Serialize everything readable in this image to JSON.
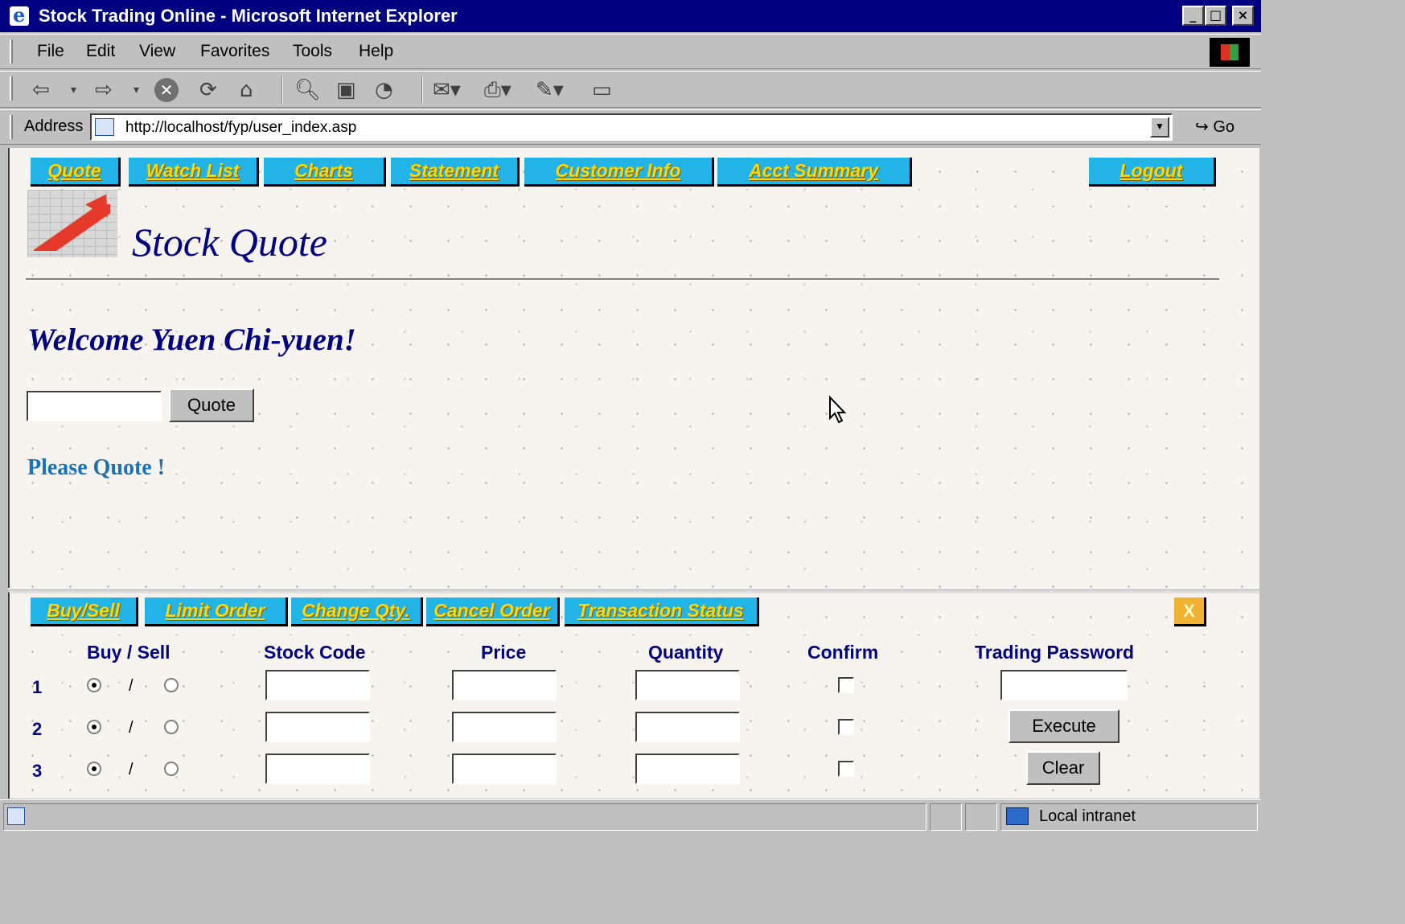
{
  "window": {
    "title": "Stock Trading Online - Microsoft Internet Explorer",
    "controls": [
      "_",
      "□",
      "×"
    ]
  },
  "menu": {
    "items": [
      {
        "label": "File"
      },
      {
        "label": "Edit"
      },
      {
        "label": "View"
      },
      {
        "label": "Favorites"
      },
      {
        "label": "Tools"
      },
      {
        "label": "Help"
      }
    ]
  },
  "toolbar": {
    "icons": [
      "back-icon",
      "forward-icon",
      "stop-icon",
      "refresh-icon",
      "home-icon",
      "search-icon",
      "favorites-icon",
      "history-icon",
      "mail-icon",
      "print-icon",
      "edit-icon",
      "fullscreen-icon"
    ]
  },
  "address": {
    "label": "Address",
    "url": "http://localhost/fyp/user_index.asp",
    "go_label": "Go"
  },
  "top_nav": {
    "items": [
      {
        "label": "Quote"
      },
      {
        "label": "Watch List"
      },
      {
        "label": "Charts"
      },
      {
        "label": "Statement"
      },
      {
        "label": "Customer Info"
      },
      {
        "label": "Acct Summary"
      }
    ],
    "logout": "Logout"
  },
  "page": {
    "title": "Stock Quote",
    "welcome": "Welcome Yuen Chi-yuen!",
    "quote_input_value": "",
    "quote_button": "Quote",
    "message": "Please Quote !"
  },
  "trade_nav": {
    "items": [
      {
        "label": "Buy/Sell"
      },
      {
        "label": "Limit Order"
      },
      {
        "label": "Change Qty."
      },
      {
        "label": "Cancel Order"
      },
      {
        "label": "Transaction Status"
      }
    ],
    "close": "X"
  },
  "trade_form": {
    "headers": {
      "buy_sell": "Buy / Sell",
      "stock_code": "Stock Code",
      "price": "Price",
      "quantity": "Quantity",
      "confirm": "Confirm",
      "trading_password": "Trading Password"
    },
    "rows": [
      {
        "num": "1",
        "buy_selected": true,
        "separator": "/",
        "stock_code": "",
        "price": "",
        "quantity": "",
        "confirm": false
      },
      {
        "num": "2",
        "buy_selected": true,
        "separator": "/",
        "stock_code": "",
        "price": "",
        "quantity": "",
        "confirm": false
      },
      {
        "num": "3",
        "buy_selected": true,
        "separator": "/",
        "stock_code": "",
        "price": "",
        "quantity": "",
        "confirm": false
      }
    ],
    "password_value": "",
    "execute_button": "Execute",
    "clear_button": "Clear"
  },
  "status_bar": {
    "zone": "Local intranet"
  },
  "colors": {
    "titlebar": "#000080",
    "nav_button_bg": "#22b4e6",
    "nav_button_text": "#ffd800",
    "heading": "#000080",
    "message": "#1a73b8"
  }
}
